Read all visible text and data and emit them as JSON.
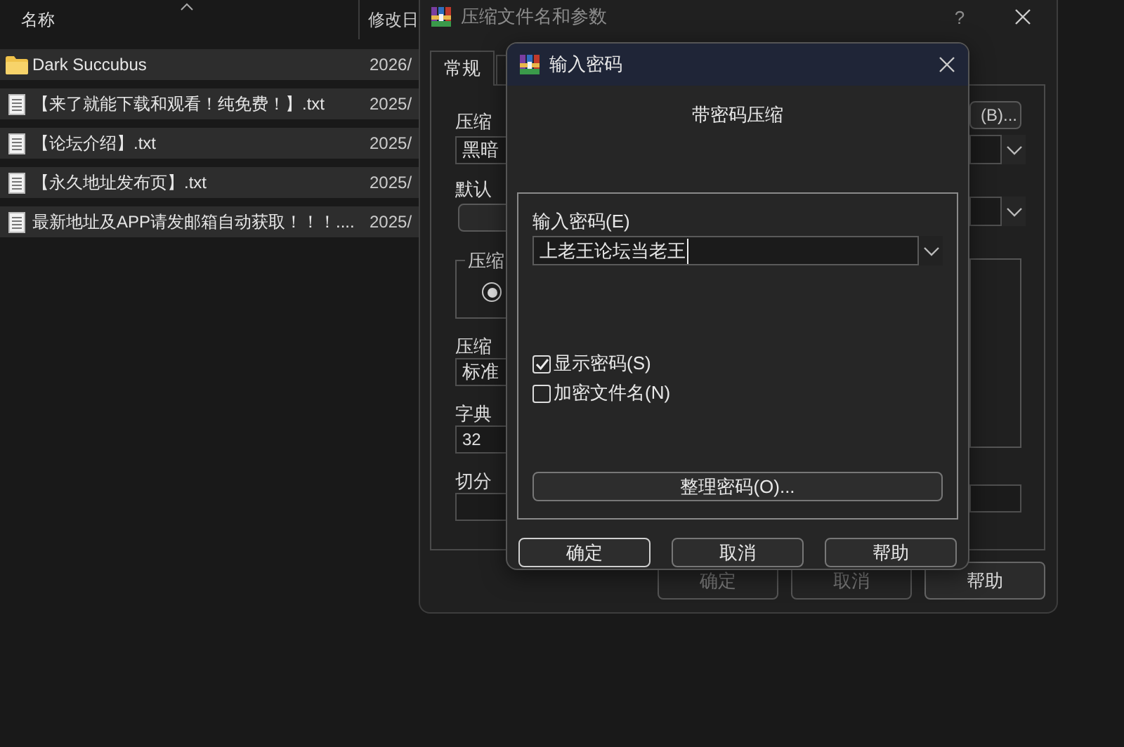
{
  "explorer": {
    "columns": [
      {
        "label": "名称"
      },
      {
        "label": "修改日"
      }
    ],
    "rows": [
      {
        "kind": "folder",
        "name": "Dark Succubus",
        "date": "2026/",
        "selected": true
      },
      {
        "kind": "file",
        "name": "【来了就能下载和观看！纯免费！】.txt",
        "date": "2025/",
        "selected": true
      },
      {
        "kind": "file",
        "name": "【论坛介绍】.txt",
        "date": "2025/",
        "selected": true
      },
      {
        "kind": "file",
        "name": "【永久地址发布页】.txt",
        "date": "2025/",
        "selected": true
      },
      {
        "kind": "file",
        "name": "最新地址及APP请发邮箱自动获取！！！....",
        "date": "2025/",
        "selected": true
      }
    ]
  },
  "archive_dialog": {
    "title": "压缩文件名和参数",
    "help": "?",
    "tabs": [
      {
        "label": "常规",
        "selected": true
      },
      {
        "selected": false
      }
    ],
    "archive_name_label": "压缩",
    "archive_name": "黑暗",
    "browse_button": "(B)...",
    "profile_label": "默认",
    "format_group_label": "压缩",
    "format_option": {
      "selected": true
    },
    "method_label": "压缩",
    "method": "标准",
    "dictionary_label": "字典",
    "dictionary": "32",
    "split_label": "切分",
    "buttons": [
      {
        "label": "确定",
        "disabled": true
      },
      {
        "label": "取消",
        "disabled": true
      },
      {
        "label": "帮助",
        "disabled": false
      }
    ]
  },
  "password_dialog": {
    "title": "输入密码",
    "heading": "带密码压缩",
    "password_label": "输入密码(E)",
    "password": "上老王论坛当老王",
    "options": [
      {
        "label": "显示密码(S)",
        "checked": true
      },
      {
        "label": "加密文件名(N)",
        "checked": false
      }
    ],
    "organize_button": "整理密码(O)...",
    "buttons": [
      {
        "label": "确定",
        "default": true
      },
      {
        "label": "取消",
        "default": false
      },
      {
        "label": "帮助",
        "default": false
      }
    ]
  }
}
